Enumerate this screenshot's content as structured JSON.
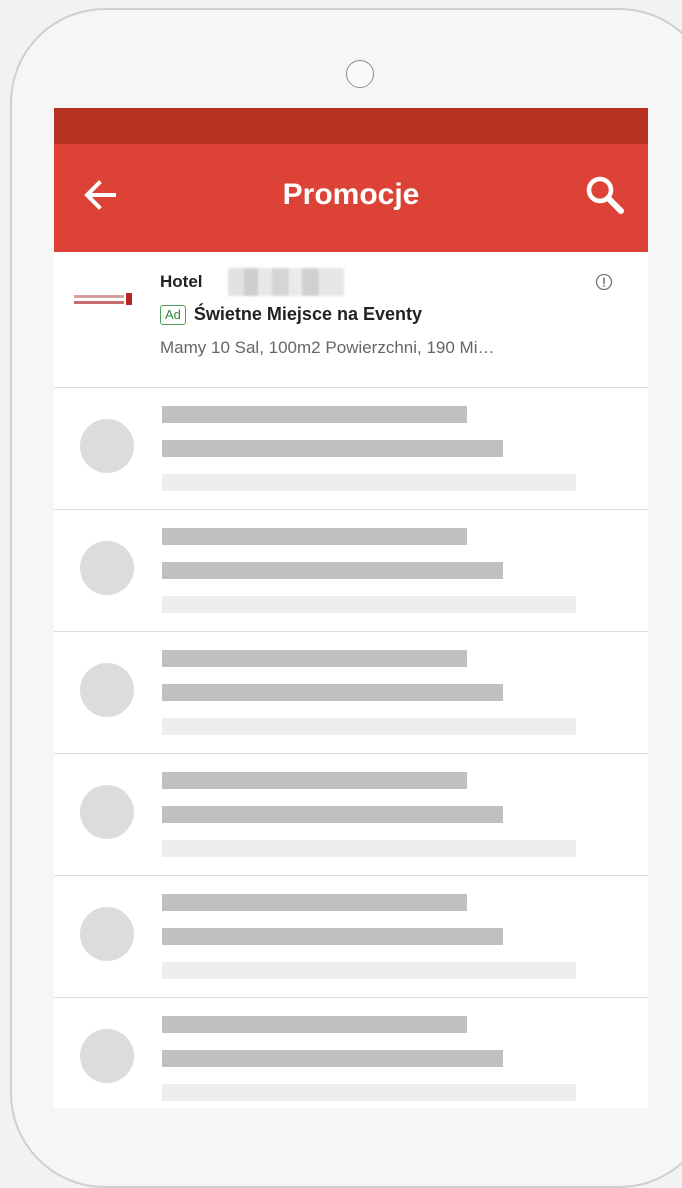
{
  "colors": {
    "statusbar": "#b83020",
    "appbar": "#dc4236",
    "ad_badge": "#2e8b3e",
    "placeholder_dark": "#c0c0c0",
    "placeholder_light": "#eeeeee"
  },
  "appbar": {
    "title": "Promocje",
    "back_icon": "arrow-left-icon",
    "search_icon": "search-icon"
  },
  "ad": {
    "advertiser": "Hotel",
    "badge": "Ad",
    "headline": "Świetne Miejsce na Eventy",
    "description": "Mamy 10 Sal, 100m2 Powierzchni, 190 Mi…",
    "info_icon": "info-icon"
  },
  "placeholder_rows": 6
}
